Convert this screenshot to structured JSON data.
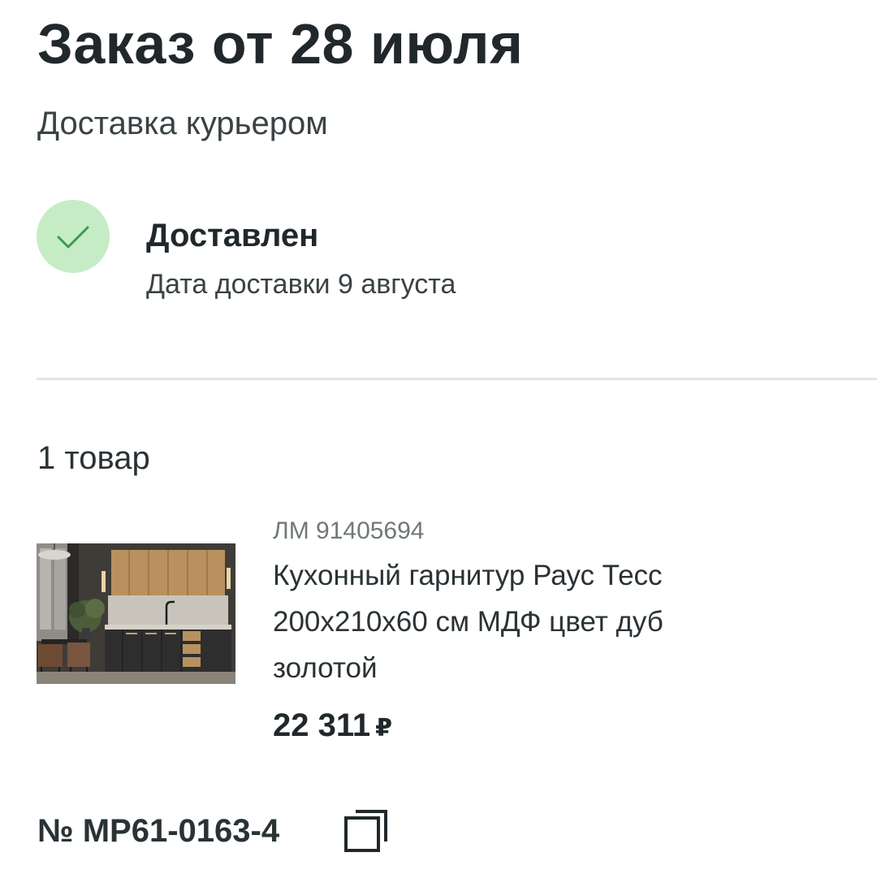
{
  "order": {
    "title": "Заказ от 28 июля",
    "delivery_method": "Доставка курьером",
    "number": "№ МР61-0163-4"
  },
  "status": {
    "icon": "check-icon",
    "title": "Доставлен",
    "date": "Дата доставки 9 августа",
    "color": "#c6ecc6"
  },
  "items": {
    "count_label": "1 товар",
    "list": [
      {
        "sku": "ЛМ 91405694",
        "name": "Кухонный гарнитур Раус Тесс 200x210x60 см МДФ цвет дуб золотой",
        "price": "22 311",
        "currency": "₽",
        "image": "kitchen-set-photo"
      }
    ]
  },
  "actions": {
    "copy_icon": "copy-icon"
  }
}
